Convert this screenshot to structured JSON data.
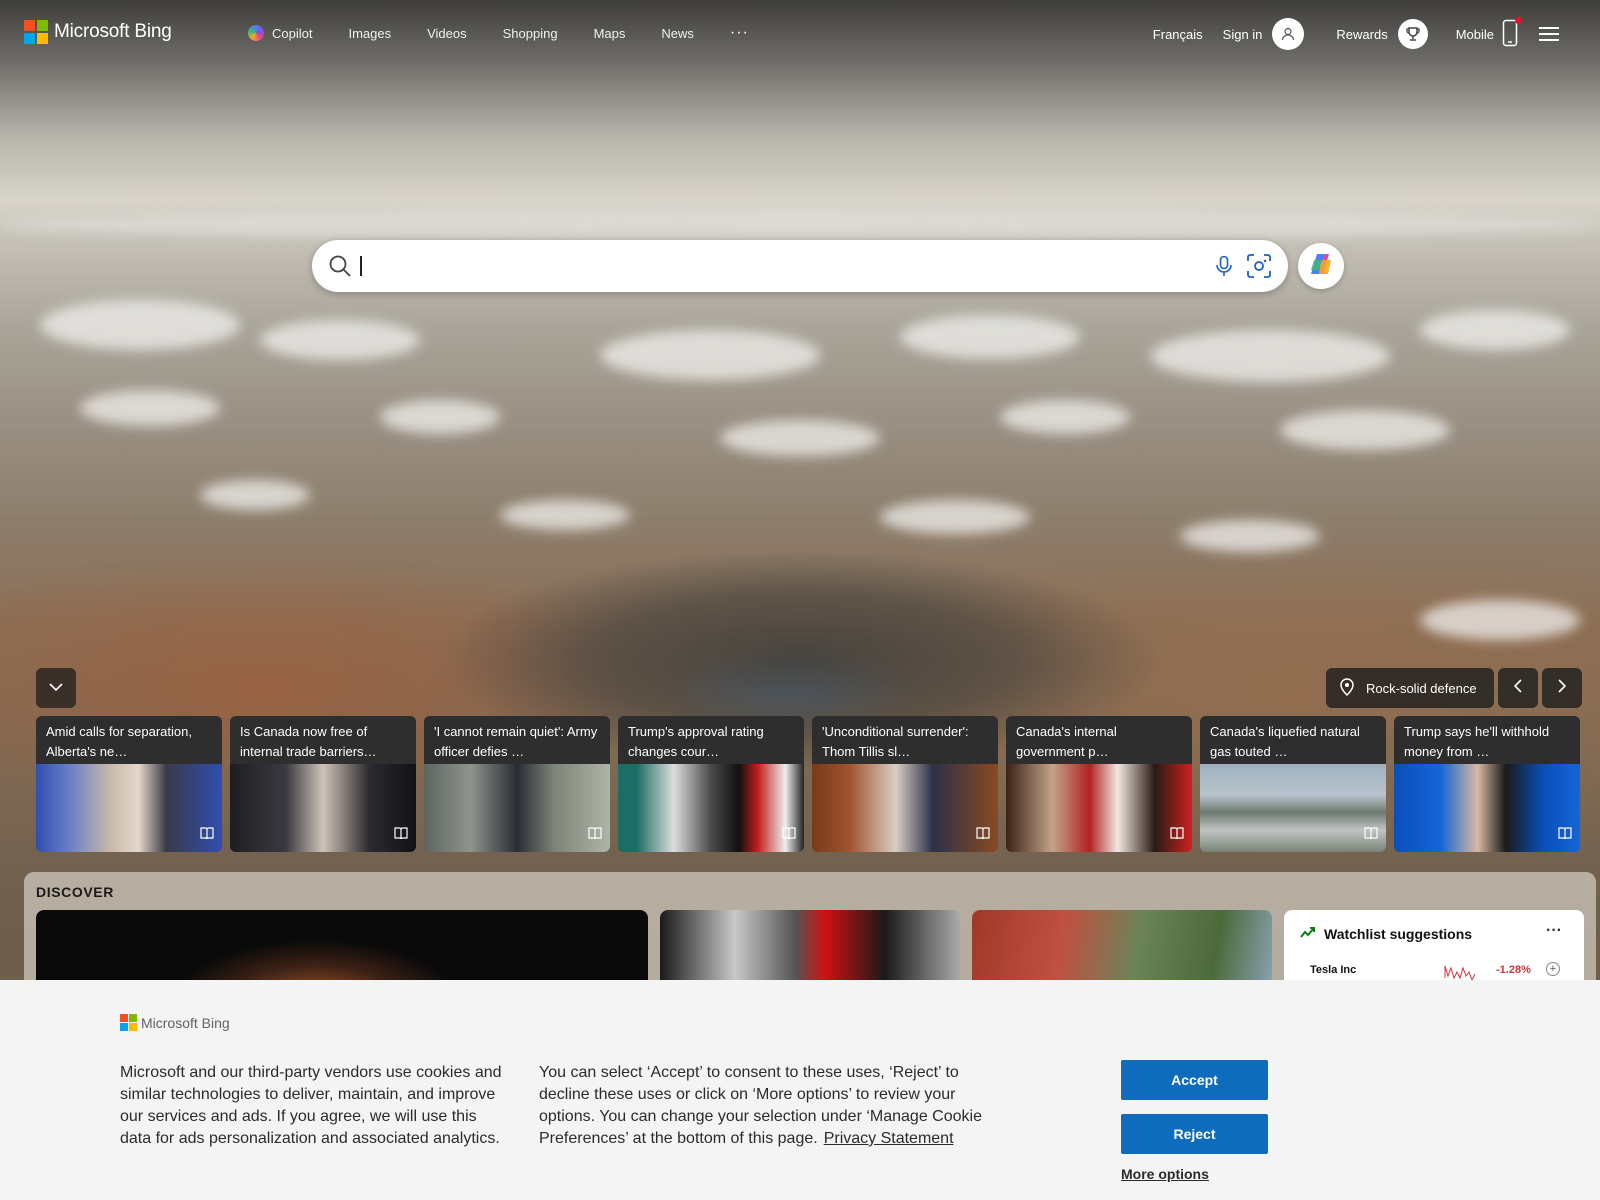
{
  "brand": {
    "name": "Microsoft Bing"
  },
  "nav": {
    "items": [
      {
        "label": "Copilot",
        "icon": "copilot-icon"
      },
      {
        "label": "Images"
      },
      {
        "label": "Videos"
      },
      {
        "label": "Shopping"
      },
      {
        "label": "Maps"
      },
      {
        "label": "News"
      }
    ],
    "more": "···"
  },
  "header_right": {
    "language": "Français",
    "sign_in": "Sign in",
    "rewards": "Rewards",
    "mobile": "Mobile"
  },
  "search": {
    "value": "",
    "placeholder": ""
  },
  "image_info": {
    "label": "Rock-solid defence"
  },
  "news_cards": [
    {
      "title": "Amid calls for separation, Alberta's ne…"
    },
    {
      "title": "Is Canada now free of internal trade barriers…"
    },
    {
      "title": "'I cannot remain quiet': Army officer defies …"
    },
    {
      "title": "Trump's approval rating changes cour…"
    },
    {
      "title": "'Unconditional surrender': Thom Tillis sl…"
    },
    {
      "title": "Canada's internal government p…"
    },
    {
      "title": "Canada's liquefied natural gas touted …"
    },
    {
      "title": "Trump says he'll withhold money from …"
    }
  ],
  "discover": {
    "title": "DISCOVER"
  },
  "watchlist": {
    "title": "Watchlist suggestions",
    "more": "···",
    "rows": [
      {
        "name": "Tesla Inc",
        "change": "-1.28%"
      }
    ]
  },
  "cookie": {
    "brand": "Microsoft Bing",
    "text1": "Microsoft and our third-party vendors use cookies and similar technologies to deliver, maintain, and improve our services and ads. If you agree, we will use this data for ads personalization and associated analytics.",
    "text2": "You can select ‘Accept’ to consent to these uses, ‘Reject’ to decline these uses or click on ‘More options’ to review your options. You can change your selection under ‘Manage Cookie Preferences’ at the bottom of this page.",
    "privacy_link": "Privacy Statement",
    "accept": "Accept",
    "reject": "Reject",
    "more_options": "More options"
  },
  "colors": {
    "accent": "#0f6cbd",
    "negative": "#d13438",
    "ms_red": "#f25022",
    "ms_green": "#7fba00",
    "ms_blue": "#00a4ef",
    "ms_yellow": "#ffb900"
  }
}
